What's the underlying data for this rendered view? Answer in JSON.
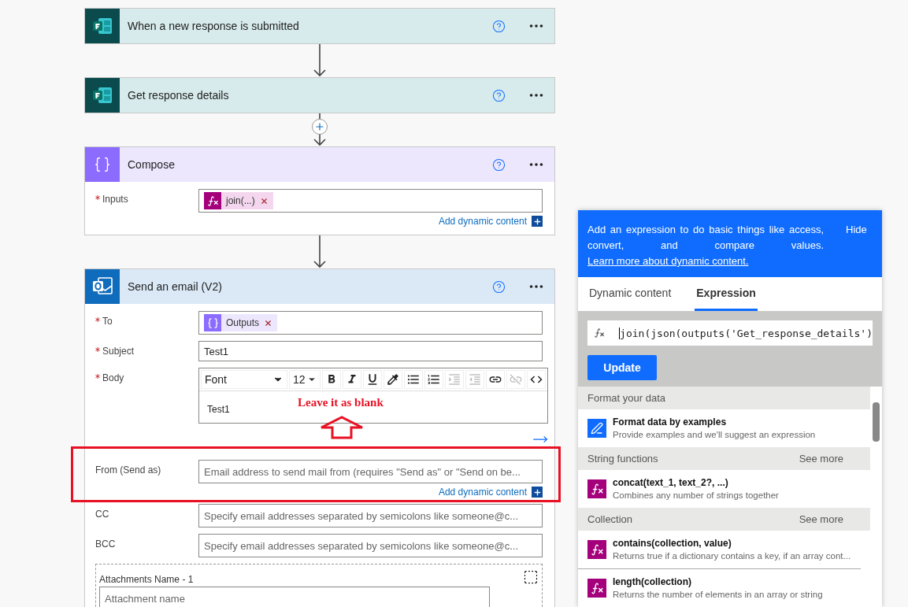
{
  "flow": [
    {
      "kind": "forms",
      "title": "When a new response is submitted",
      "help": true
    },
    {
      "kind": "forms",
      "insert_button": false,
      "title": "Get response details",
      "help": true
    },
    {
      "kind": "compose",
      "insert_button": true,
      "title": "Compose",
      "help": true,
      "fields": [
        {
          "kind": "tokens",
          "label": "Inputs",
          "required": true,
          "tokens": [
            {
              "kind": "expression",
              "text": "join(...)"
            }
          ],
          "add_dynamic": "Add dynamic content"
        }
      ]
    },
    {
      "kind": "outlook",
      "insert_button": false,
      "title": "Send an email (V2)",
      "help": true,
      "fields": [
        {
          "kind": "tokens",
          "label": "To",
          "required": true,
          "tokens": [
            {
              "kind": "compose",
              "text": "Outputs"
            }
          ]
        },
        {
          "kind": "text",
          "label": "Subject",
          "required": true,
          "value": "Test1"
        },
        {
          "kind": "editor",
          "label": "Body",
          "required": true,
          "font": "Font",
          "size": "12",
          "value": "Test1",
          "tools": [
            {
              "kind": "bold",
              "disabled": false
            },
            {
              "kind": "italic",
              "disabled": false
            },
            {
              "kind": "underline",
              "disabled": false
            },
            {
              "kind": "color",
              "disabled": false
            },
            {
              "kind": "bullets",
              "disabled": false
            },
            {
              "kind": "numbers",
              "disabled": false
            },
            {
              "kind": "indent",
              "disabled": true
            },
            {
              "kind": "outdent",
              "disabled": true
            },
            {
              "kind": "link",
              "disabled": false
            },
            {
              "kind": "unlink",
              "disabled": true
            },
            {
              "kind": "code",
              "disabled": false
            }
          ]
        },
        {
          "kind": "text",
          "label": "From (Send as)",
          "required": false,
          "highlighted": true,
          "placeholder": "Email address to send mail from (requires \"Send as\" or \"Send on be...",
          "add_dynamic": "Add dynamic content"
        },
        {
          "kind": "text",
          "label": "CC",
          "required": false,
          "placeholder": "Specify email addresses separated by semicolons like someone@c..."
        },
        {
          "kind": "text",
          "label": "BCC",
          "required": false,
          "placeholder": "Specify email addresses separated by semicolons like someone@c..."
        },
        {
          "kind": "attachment",
          "label": "Attachments Name - 1",
          "placeholder": "Attachment name"
        }
      ]
    }
  ],
  "annotation": {
    "text": "Leave it as blank"
  },
  "panel": {
    "info": "Add an expression to do basic things like access, convert, and compare values.",
    "info_link": "Learn more about dynamic content.",
    "hide": "Hide",
    "tabs": [
      {
        "label": "Dynamic content",
        "selected": false
      },
      {
        "label": "Expression",
        "selected": true
      }
    ],
    "expression": "join(json(outputs('Get_response_details')",
    "update": "Update",
    "sections": [
      {
        "title": "Format your data",
        "items": [
          {
            "kind": "format",
            "name": "Format data by examples",
            "description": "Provide examples and we'll suggest an expression"
          }
        ]
      },
      {
        "title": "String functions",
        "see_more": "See more",
        "items": [
          {
            "kind": "function",
            "name": "concat(text_1, text_2?, ...)",
            "description": "Combines any number of strings together"
          }
        ]
      },
      {
        "title": "Collection",
        "see_more": "See more",
        "items": [
          {
            "kind": "function",
            "name": "contains(collection, value)",
            "description": "Returns true if a dictionary contains a key, if an array cont..."
          },
          {
            "kind": "function",
            "name": "length(collection)",
            "description": "Returns the number of elements in an array or string"
          }
        ]
      }
    ]
  }
}
